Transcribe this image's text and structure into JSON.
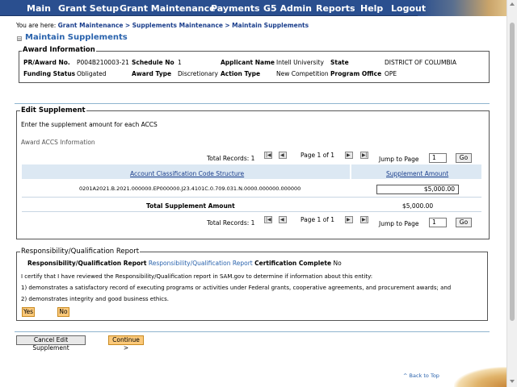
{
  "nav": {
    "items": [
      "Main",
      "Grant Setup",
      "Grant Maintenance",
      "Payments",
      "G5 Admin",
      "Reports",
      "Help",
      "Logout"
    ]
  },
  "breadcrumb": {
    "prefix": "You are here:",
    "items": [
      "Grant Maintenance",
      "Supplements Maintenance",
      "Maintain Supplements"
    ],
    "separator": ">"
  },
  "page_title": "Maintain Supplements",
  "award_info": {
    "legend": "Award Information",
    "pr_award_label": "PR/Award No.",
    "pr_award_value": "P004B210003-21",
    "schedule_label": "Schedule No",
    "schedule_value": "1",
    "applicant_label": "Applicant Name",
    "applicant_value": "Intell University",
    "state_label": "State",
    "state_value": "DISTRICT OF COLUMBIA",
    "funding_label": "Funding Status",
    "funding_value": "Obligated",
    "award_type_label": "Award Type",
    "award_type_value": "Discretionary",
    "action_type_label": "Action Type",
    "action_type_value": "New Competition",
    "program_office_label": "Program Office",
    "program_office_value": "OPE"
  },
  "edit_supplement": {
    "legend": "Edit Supplement",
    "instruction": "Enter the supplement amount for each ACCS",
    "section_label": "Award ACCS Information",
    "total_records_label": "Total Records:",
    "total_records": "1",
    "page_info": "Page 1 of 1",
    "jump_label": "Jump to Page",
    "jump_value": "1",
    "go_label": "Go",
    "col_accs": "Account Classification Code Structure",
    "col_amount": "Supplement Amount",
    "rows": [
      {
        "accs": "0201A2021.B.2021.000000.EP000000.J23.4101C.0.709.031.N.0000.000000.000000",
        "amount": "$5,000.00"
      }
    ],
    "total_label": "Total Supplement Amount",
    "total_value": "$5,000.00"
  },
  "responsibility": {
    "legend": "Responsibility/Qualification Report",
    "label": "Responsibility/Qualification Report",
    "link": "Responsibility/Qualification Report",
    "cert_label": "Certification Complete",
    "cert_value": "No",
    "certify_text": "I certify that I have reviewed the Responsibility/Qualification report in SAM.gov to determine if information about this entity:",
    "item1": "1) demonstrates a satisfactory record of executing programs or activities under Federal grants, cooperative agreements, and procurement awards; and",
    "item2": "2) demonstrates integrity and good business ethics.",
    "yes_label": "Yes",
    "no_label": "No"
  },
  "actions": {
    "cancel_label": "Cancel Edit Supplement",
    "continue_label": "Continue >"
  },
  "back_to_top": "^ Back to Top",
  "pager_icons": [
    "first-page-icon",
    "prev-page-icon",
    "next-page-icon",
    "last-page-icon"
  ],
  "colors": {
    "nav_bg": "#2a4f8f",
    "link": "#1a3e8c",
    "title": "#2a63ad",
    "table_header_bg": "#dce8f3",
    "orange_button": "#fbc97a"
  }
}
